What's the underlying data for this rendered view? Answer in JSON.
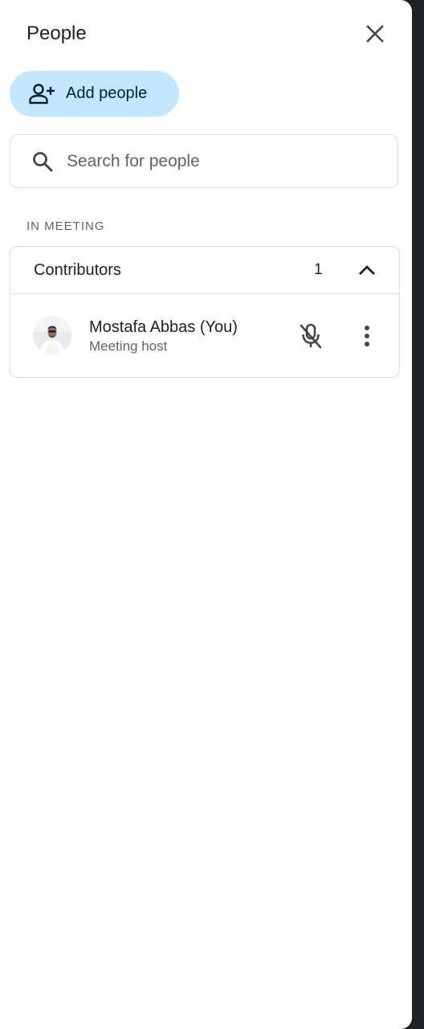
{
  "panel": {
    "title": "People",
    "close_icon": "close-icon"
  },
  "add_people": {
    "label": "Add people",
    "icon": "person-add-icon",
    "background": "#c2e7ff"
  },
  "search": {
    "placeholder": "Search for people",
    "icon": "search-icon"
  },
  "section_label": "IN MEETING",
  "group": {
    "name": "Contributors",
    "count": "1",
    "chevron_icon": "chevron-up-icon",
    "participants": [
      {
        "name": "Mostafa Abbas (You)",
        "role": "Meeting host",
        "mic_icon": "mic-off-icon",
        "more_icon": "more-vert-icon"
      }
    ]
  }
}
